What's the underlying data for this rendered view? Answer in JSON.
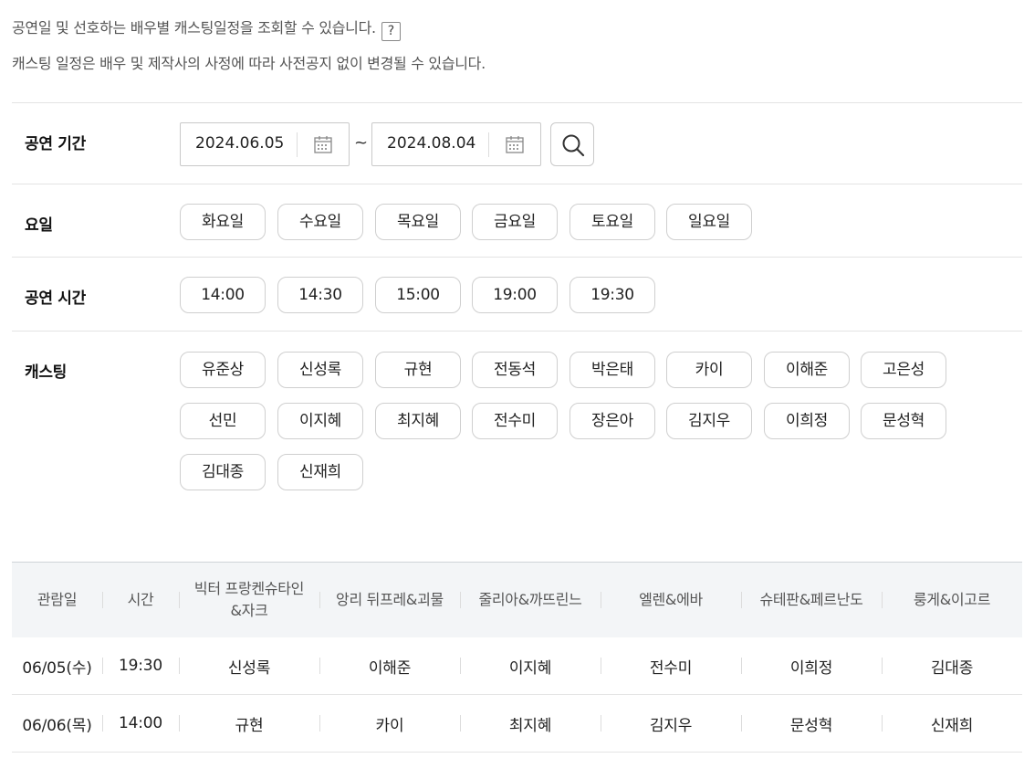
{
  "notices": {
    "line1": "공연일 및 선호하는 배우별 캐스팅일정을 조회할 수 있습니다.",
    "help": "?",
    "line2": "캐스팅 일정은 배우 및 제작사의 사정에 따라 사전공지 없이 변경될 수 있습니다."
  },
  "filters": {
    "period_label": "공연 기간",
    "date_from": "2024.06.05",
    "tilde": "~",
    "date_to": "2024.08.04",
    "days_label": "요일",
    "days": [
      "화요일",
      "수요일",
      "목요일",
      "금요일",
      "토요일",
      "일요일"
    ],
    "times_label": "공연 시간",
    "times": [
      "14:00",
      "14:30",
      "15:00",
      "19:00",
      "19:30"
    ],
    "cast_label": "캐스팅",
    "cast": [
      "유준상",
      "신성록",
      "규현",
      "전동석",
      "박은태",
      "카이",
      "이해준",
      "고은성",
      "선민",
      "이지혜",
      "최지혜",
      "전수미",
      "장은아",
      "김지우",
      "이희정",
      "문성혁",
      "김대종",
      "신재희"
    ]
  },
  "schedule": {
    "headers": [
      "관람일",
      "시간",
      "빅터 프랑켄슈타인&자크",
      "앙리 뒤프레&괴물",
      "줄리아&까뜨린느",
      "엘렌&에바",
      "슈테판&페르난도",
      "룽게&이고르"
    ],
    "rows": [
      [
        "06/05(수)",
        "19:30",
        "신성록",
        "이해준",
        "이지혜",
        "전수미",
        "이희정",
        "김대종"
      ],
      [
        "06/06(목)",
        "14:00",
        "규현",
        "카이",
        "최지혜",
        "김지우",
        "문성혁",
        "신재희"
      ]
    ]
  },
  "colors": {
    "border": "#c9c9c9",
    "header_bg": "#f3f5f7",
    "text": "#222222",
    "muted": "#555555"
  }
}
